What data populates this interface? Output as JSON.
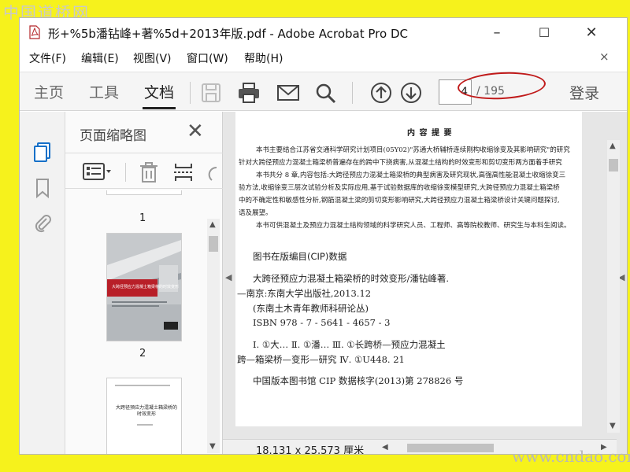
{
  "watermark_top": "中国道桥网",
  "watermark_bottom": "www.cndao.com",
  "window": {
    "title": "形+%5b潘钻峰+著%5d+2013年版.pdf - Adobe Acrobat Pro DC",
    "minimize": "–",
    "maximize": "☐",
    "close": "✕"
  },
  "menu": {
    "items": [
      "文件(F)",
      "编辑(E)",
      "视图(V)",
      "窗口(W)",
      "帮助(H)"
    ],
    "close": "×"
  },
  "toolbar": {
    "tabs": [
      "主页",
      "工具",
      "文档"
    ],
    "active_tab": "文档",
    "page_current": "4",
    "page_total": "/ 195",
    "login": "登录",
    "highlight_color": "#c01a1a"
  },
  "thumbnail_panel": {
    "title": "页面缩略图",
    "close": "✕",
    "pages": [
      {
        "num": "1"
      },
      {
        "num": "2",
        "cover_title": "大跨径预应力混凝土箱梁桥的时效变形"
      },
      {
        "num": "",
        "cover_title": "大跨径预应力混凝土箱梁桥的时效变形"
      }
    ]
  },
  "document": {
    "heading": "内 容 提 要",
    "abstract_lines": [
      "本书主要结合江苏省交通科学研究计划项目(05Y02)\"苏通大桥辅桥连续刚构收缩徐变及其影响研究\"的研究",
      "针对大跨径预应力混凝土箱梁桥普遍存在的跨中下挠病害,从混凝土结构的时效变形和剪切变形两方面着手研究",
      "本书共分 8 章,内容包括:大跨径预应力混凝土箱梁桥的典型病害及研究现状,高强高性能混凝土收缩徐变三",
      "验方法,收缩徐变三层次试验分析及实际应用,基于试验数据库的收缩徐变模型研究,大跨径预应力混凝土箱梁桥",
      "中的不确定性和敏感性分析,钢筋混凝土梁的剪切变形影响研究,大跨径预应力混凝土箱梁桥设计关键问题探讨,",
      "语及展望。",
      "本书可供混凝土及预应力混凝土结构领域的科学研究人员、工程师、高等院校教师、研究生与本科生阅读。"
    ],
    "cip_title": "图书在版编目(CIP)数据",
    "cip_lines": [
      "大跨径预应力混凝土箱梁桥的时效变形/潘钻峰著.",
      "—南京:东南大学出版社,2013.12",
      "(东南土木青年教师科研论丛)",
      "ISBN 978 - 7 - 5641 - 4657 - 3"
    ],
    "class_lines": [
      "Ⅰ. ①大…   Ⅱ. ①潘…   Ⅲ. ①长跨桥—预应力混凝土",
      "跨—箱梁桥—变形—研究   Ⅳ. ①U448. 21"
    ],
    "cip_number": "中国版本图书馆 CIP 数据核字(2013)第 278826 号"
  },
  "status": {
    "page_size": "18.131 x 25.573 厘米"
  }
}
